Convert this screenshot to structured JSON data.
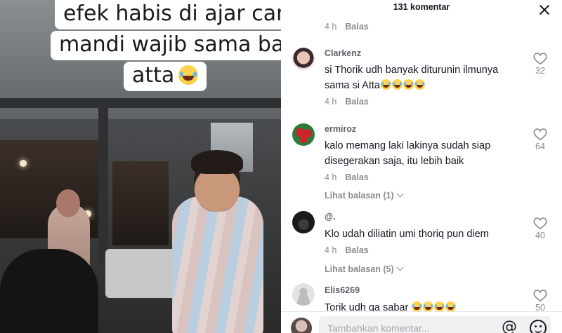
{
  "video": {
    "caption_lines": [
      "efek habis di ajar cara",
      "mandi wajib sama bang",
      "atta"
    ]
  },
  "comments_panel": {
    "title": "131 komentar",
    "reply_label": "Balas",
    "top_meta_time": "4 h",
    "comments": [
      {
        "username": "Clarkenz",
        "text_line1": "si Thorik udh banyak diturunin ilmunya",
        "text_line2": "sama si Atta",
        "emoji": "grinning-sweat-emoji",
        "emoji_count": 4,
        "time": "4 h",
        "likes": "32"
      },
      {
        "username": "ermiroz",
        "text_line1": "kalo memang laki lakinya sudah siap",
        "text_line2": "disegerakan saja, itu lebih baik",
        "time": "4 h",
        "likes": "64",
        "view_replies": "Lihat balasan (1)"
      },
      {
        "username": "@.",
        "text_line1": "Klo udah diliatin umi thoriq pun diem",
        "time": "4 h",
        "likes": "40",
        "view_replies": "Lihat balasan (5)"
      },
      {
        "username": "Elis6269",
        "text_line1": "Torik udh ga sabar",
        "emoji": "grinning-sweat-emoji",
        "emoji_count": 4,
        "likes": "50"
      }
    ]
  },
  "input_bar": {
    "placeholder": "Tambahkan komentar..."
  },
  "colors": {
    "text_primary": "#161823",
    "text_secondary": "#8a8b91",
    "input_bg": "#f1f1f2"
  }
}
